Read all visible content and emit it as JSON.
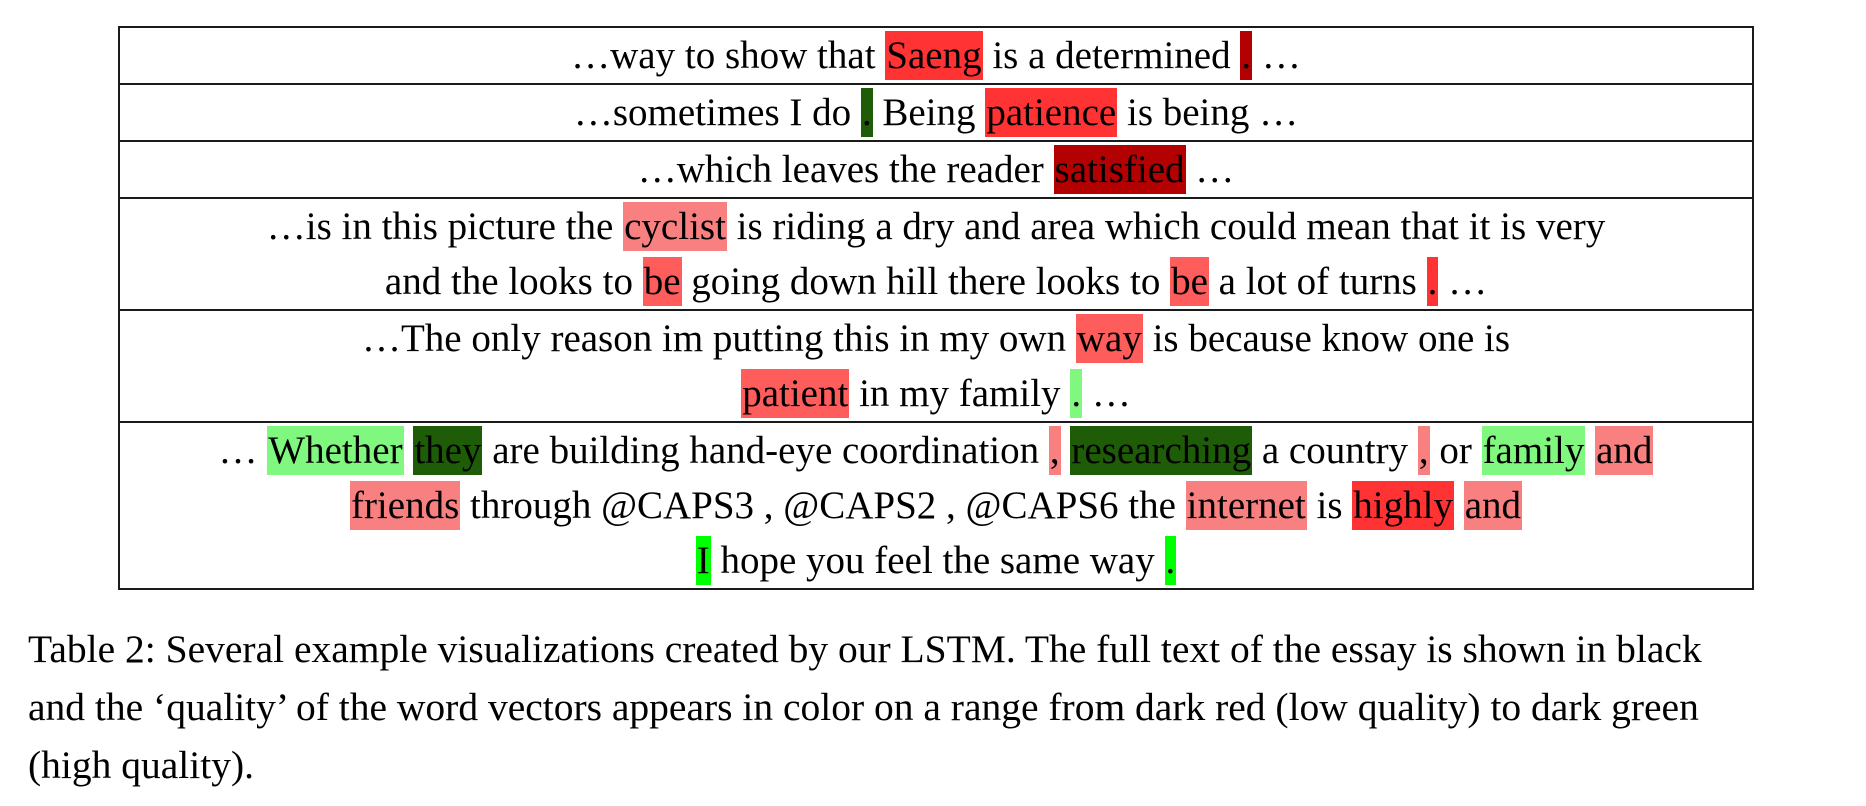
{
  "palette": {
    "dark_red": "#b30000",
    "red": "#ff3333",
    "medium_red": "#ff5c5c",
    "light_red": "#f88080",
    "light_green": "#80f880",
    "bright_green": "#00ff00",
    "dark_green": "#1e5c08"
  },
  "rows": [
    {
      "lines": [
        [
          {
            "t": "…way to show that "
          },
          {
            "t": "Saeng",
            "c": "red"
          },
          {
            "t": " is a determined "
          },
          {
            "t": ".",
            "c": "dark_red"
          },
          {
            "t": " …"
          }
        ]
      ]
    },
    {
      "lines": [
        [
          {
            "t": "…sometimes I do "
          },
          {
            "t": ".",
            "c": "dark_green"
          },
          {
            "t": " Being "
          },
          {
            "t": "patience",
            "c": "red"
          },
          {
            "t": " is being …"
          }
        ]
      ]
    },
    {
      "lines": [
        [
          {
            "t": "…which leaves the reader "
          },
          {
            "t": "satisfied",
            "c": "dark_red"
          },
          {
            "t": " …"
          }
        ]
      ]
    },
    {
      "lines": [
        [
          {
            "t": "…is in this picture the "
          },
          {
            "t": "cyclist",
            "c": "light_red"
          },
          {
            "t": " is riding a dry and area which could mean that it is very"
          }
        ],
        [
          {
            "t": "and the looks to "
          },
          {
            "t": "be",
            "c": "medium_red"
          },
          {
            "t": " going down hill there looks to "
          },
          {
            "t": "be",
            "c": "medium_red"
          },
          {
            "t": " a lot of turns "
          },
          {
            "t": ".",
            "c": "red"
          },
          {
            "t": " …"
          }
        ]
      ]
    },
    {
      "lines": [
        [
          {
            "t": "…The only reason im putting this in my own "
          },
          {
            "t": "way",
            "c": "medium_red"
          },
          {
            "t": " is because know one is"
          }
        ],
        [
          {
            "t": "patient",
            "c": "medium_red"
          },
          {
            "t": " in my family "
          },
          {
            "t": ".",
            "c": "light_green"
          },
          {
            "t": " …"
          }
        ]
      ]
    },
    {
      "lines": [
        [
          {
            "t": "… "
          },
          {
            "t": "Whether",
            "c": "light_green"
          },
          {
            "t": " "
          },
          {
            "t": "they",
            "c": "dark_green"
          },
          {
            "t": " are building hand-eye coordination "
          },
          {
            "t": ",",
            "c": "light_red"
          },
          {
            "t": " "
          },
          {
            "t": "researching",
            "c": "dark_green"
          },
          {
            "t": " a country "
          },
          {
            "t": ",",
            "c": "light_red"
          },
          {
            "t": " or "
          },
          {
            "t": "family",
            "c": "light_green"
          },
          {
            "t": " "
          },
          {
            "t": "and",
            "c": "light_red"
          }
        ],
        [
          {
            "t": "friends",
            "c": "light_red"
          },
          {
            "t": " through @CAPS3 , @CAPS2 , @CAPS6 the "
          },
          {
            "t": "internet",
            "c": "light_red"
          },
          {
            "t": " is "
          },
          {
            "t": "highly",
            "c": "red"
          },
          {
            "t": " "
          },
          {
            "t": "and",
            "c": "light_red"
          }
        ],
        [
          {
            "t": "I",
            "c": "bright_green"
          },
          {
            "t": " hope you feel the same way "
          },
          {
            "t": ".",
            "c": "bright_green"
          }
        ]
      ]
    }
  ],
  "caption": {
    "lines": [
      "Table 2: Several example visualizations created by our LSTM. The full text of the essay is shown in black",
      "and the ‘quality’ of the word vectors appears in color on a range from dark red (low quality) to dark green",
      "(high quality)."
    ]
  }
}
